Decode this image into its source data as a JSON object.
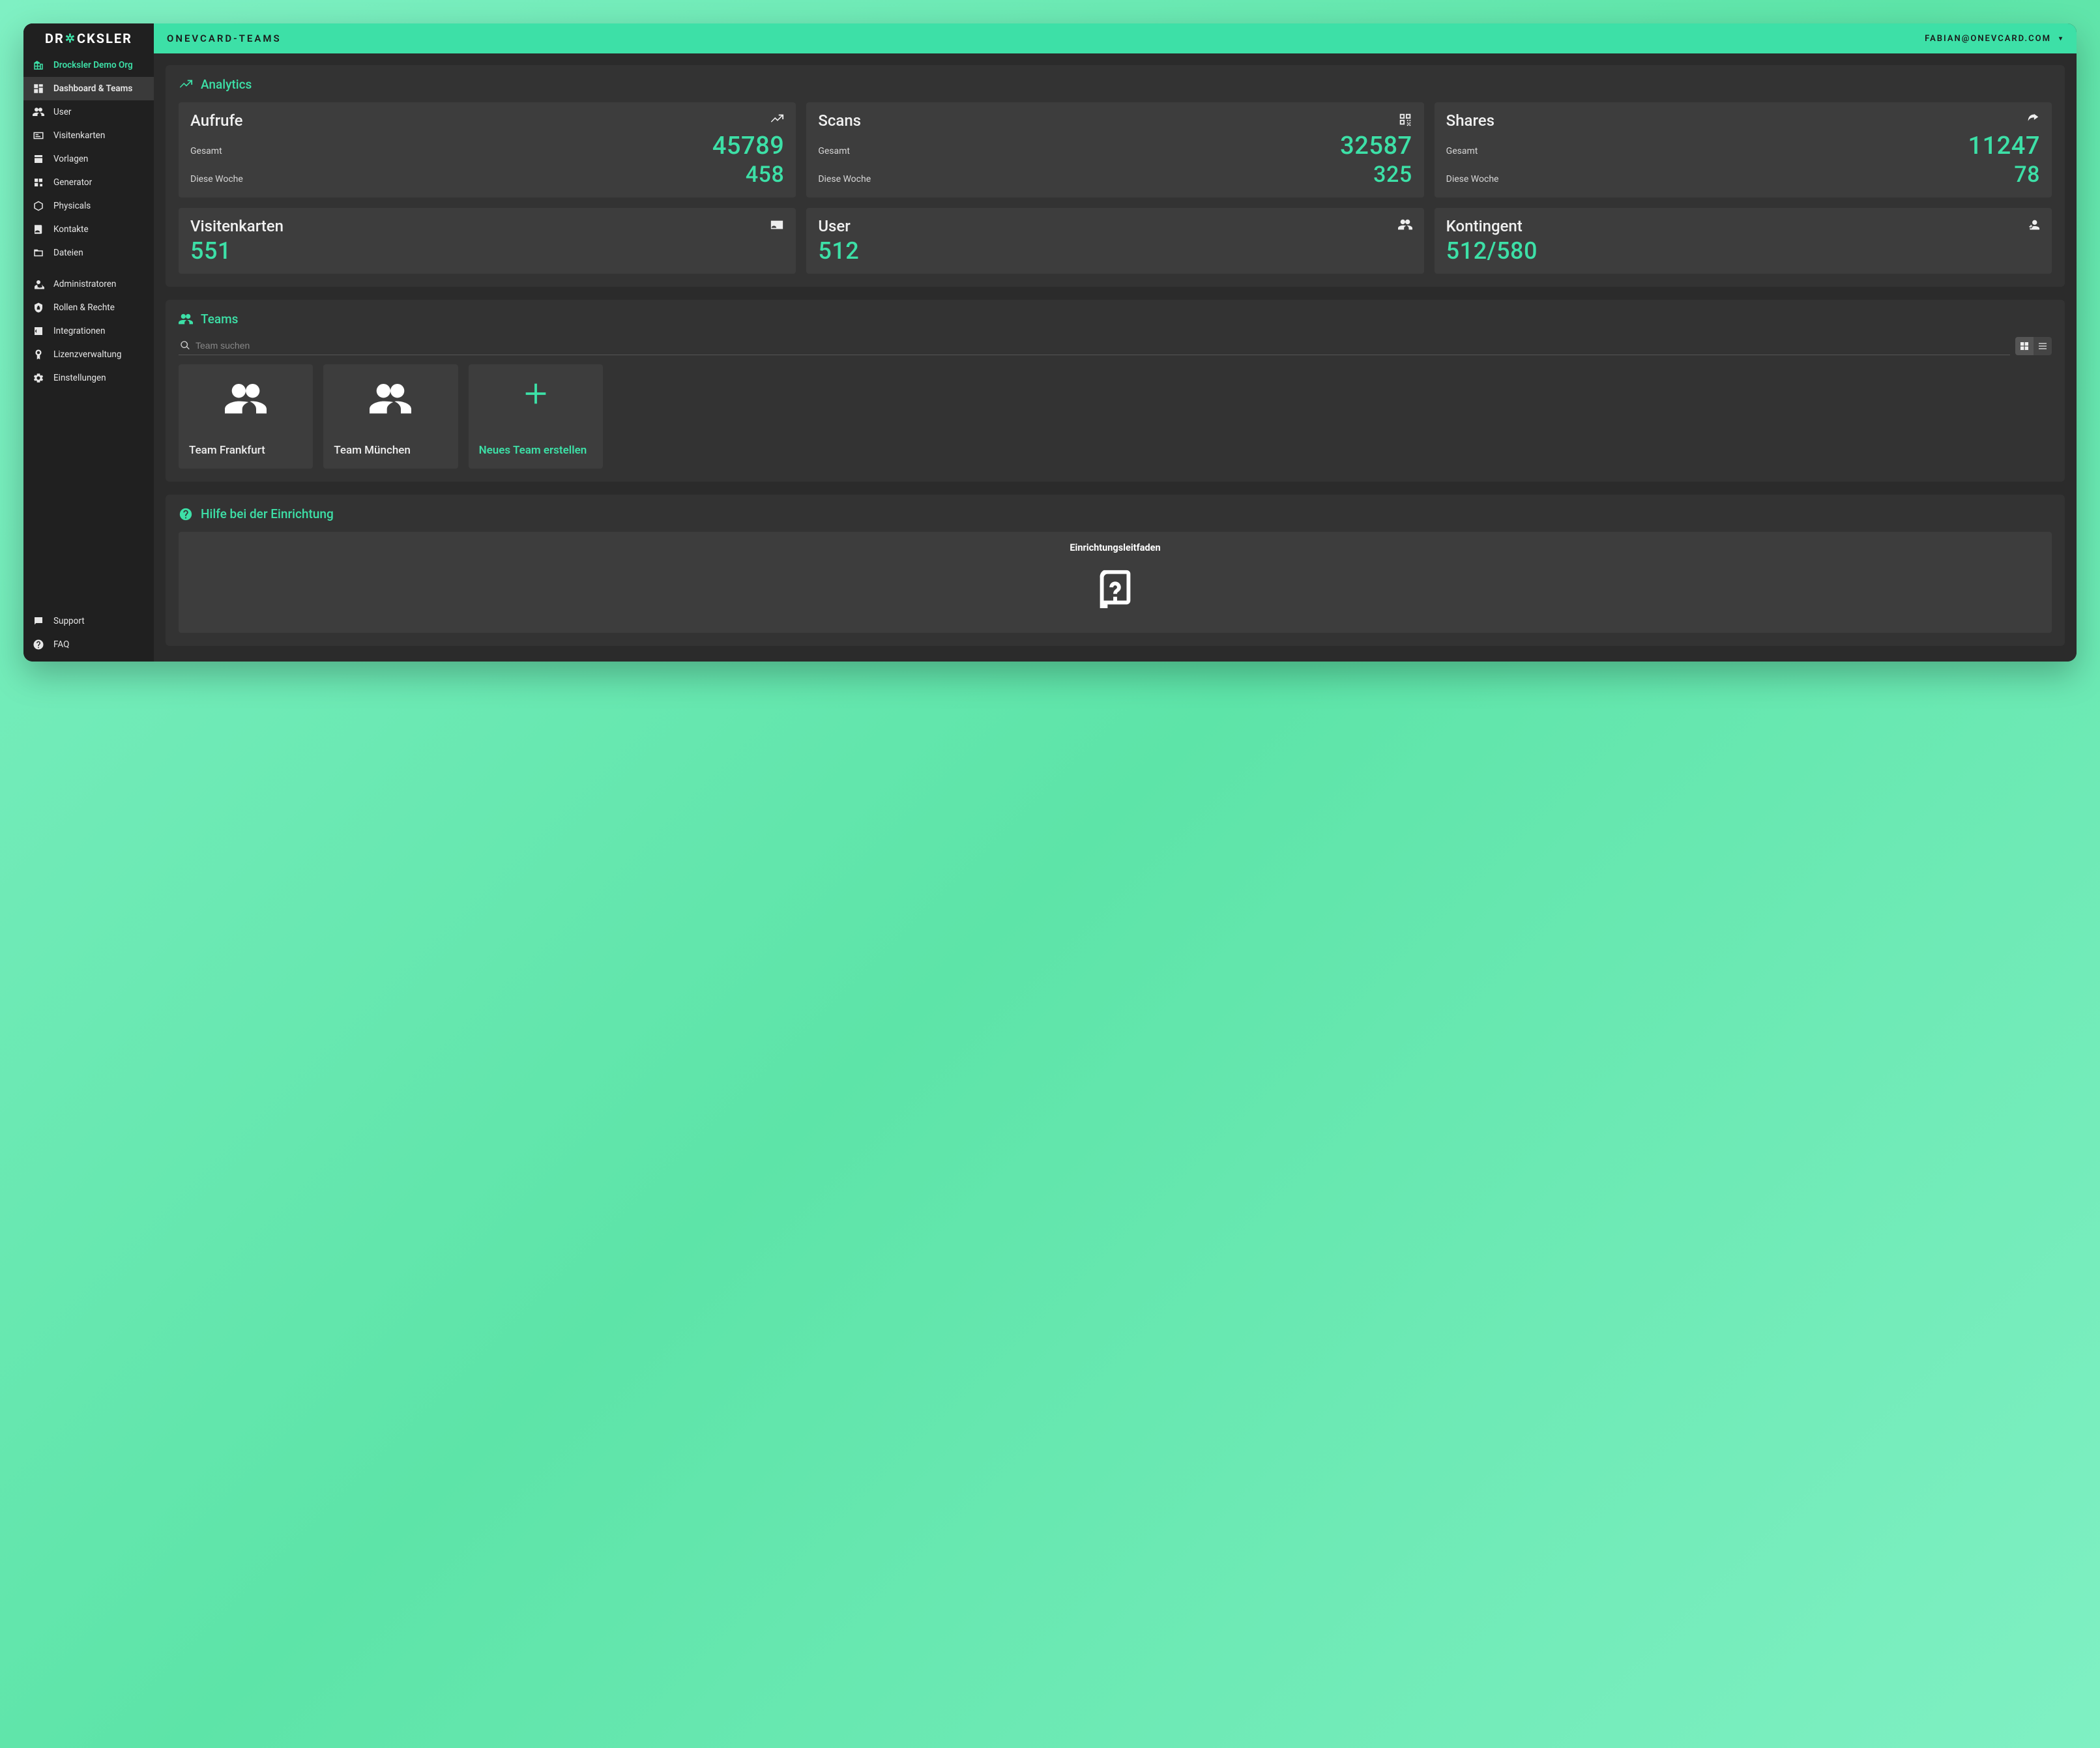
{
  "brand_logo_left": "DR",
  "brand_logo_right": "CKSLER",
  "org": {
    "name": "Drocksler Demo Org"
  },
  "nav": {
    "items": [
      {
        "label": "Dashboard & Teams",
        "active": true
      },
      {
        "label": "User"
      },
      {
        "label": "Visitenkarten"
      },
      {
        "label": "Vorlagen"
      },
      {
        "label": "Generator"
      },
      {
        "label": "Physicals"
      },
      {
        "label": "Kontakte"
      },
      {
        "label": "Dateien"
      }
    ],
    "admin": [
      {
        "label": "Administratoren"
      },
      {
        "label": "Rollen & Rechte"
      },
      {
        "label": "Integrationen"
      },
      {
        "label": "Lizenzverwaltung"
      },
      {
        "label": "Einstellungen"
      }
    ],
    "bottom": [
      {
        "label": "Support"
      },
      {
        "label": "FAQ"
      }
    ]
  },
  "topbar": {
    "brand": "ONEVCARD-TEAMS",
    "user_email": "FABIAN@ONEVCARD.COM"
  },
  "analytics": {
    "title": "Analytics",
    "total_label": "Gesamt",
    "week_label": "Diese Woche",
    "views": {
      "title": "Aufrufe",
      "total": "45789",
      "week": "458"
    },
    "scans": {
      "title": "Scans",
      "total": "32587",
      "week": "325"
    },
    "shares": {
      "title": "Shares",
      "total": "11247",
      "week": "78"
    },
    "cards": {
      "title": "Visitenkarten",
      "value": "551"
    },
    "users": {
      "title": "User",
      "value": "512"
    },
    "contingent": {
      "title": "Kontingent",
      "value": "512/580"
    }
  },
  "teams": {
    "title": "Teams",
    "search_placeholder": "Team suchen",
    "items": [
      {
        "name": "Team Frankfurt"
      },
      {
        "name": "Team München"
      }
    ],
    "new_label": "Neues Team erstellen"
  },
  "help": {
    "title": "Hilfe bei der Einrichtung",
    "guide_label": "Einrichtungsleitfaden"
  }
}
